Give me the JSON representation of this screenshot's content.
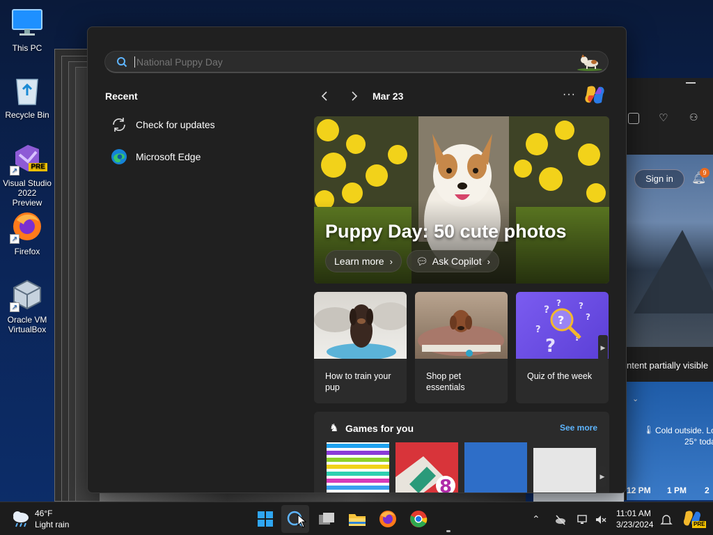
{
  "desktop": {
    "icons": [
      {
        "label": "This PC"
      },
      {
        "label": "Recycle Bin"
      },
      {
        "label": "Visual Studio 2022 Preview",
        "badge": "PRE"
      },
      {
        "label": "Firefox"
      },
      {
        "label": "Oracle VM VirtualBox"
      }
    ]
  },
  "background_window": {
    "sign_in": "Sign in",
    "notification_count": "9",
    "partial_text": "ntent partially visible",
    "weather_text_1": "Cold outside. Lo",
    "weather_text_2": "25° toda",
    "hours": [
      "12 PM",
      "1 PM",
      "2"
    ]
  },
  "search": {
    "placeholder": "National Puppy Day",
    "value": ""
  },
  "recent": {
    "title": "Recent",
    "items": [
      {
        "label": "Check for updates",
        "icon": "refresh-icon"
      },
      {
        "label": "Microsoft Edge",
        "icon": "edge-icon"
      }
    ]
  },
  "highlights": {
    "date": "Mar 23",
    "hero": {
      "title": "Puppy Day: 50 cute photos",
      "learn_more": "Learn more",
      "ask_copilot": "Ask Copilot"
    },
    "cards": [
      {
        "caption": "How to train your pup"
      },
      {
        "caption": "Shop pet essentials"
      },
      {
        "caption": "Quiz of the week"
      }
    ],
    "games": {
      "title": "Games for you",
      "see_more": "See more"
    }
  },
  "taskbar": {
    "weather_temp": "46°F",
    "weather_desc": "Light rain",
    "time": "11:01 AM",
    "date": "3/23/2024",
    "pre_badge": "PRE"
  },
  "colors": {
    "accent": "#5eb5ff",
    "panel_bg": "#202020",
    "card_bg": "#2b2b2b"
  }
}
